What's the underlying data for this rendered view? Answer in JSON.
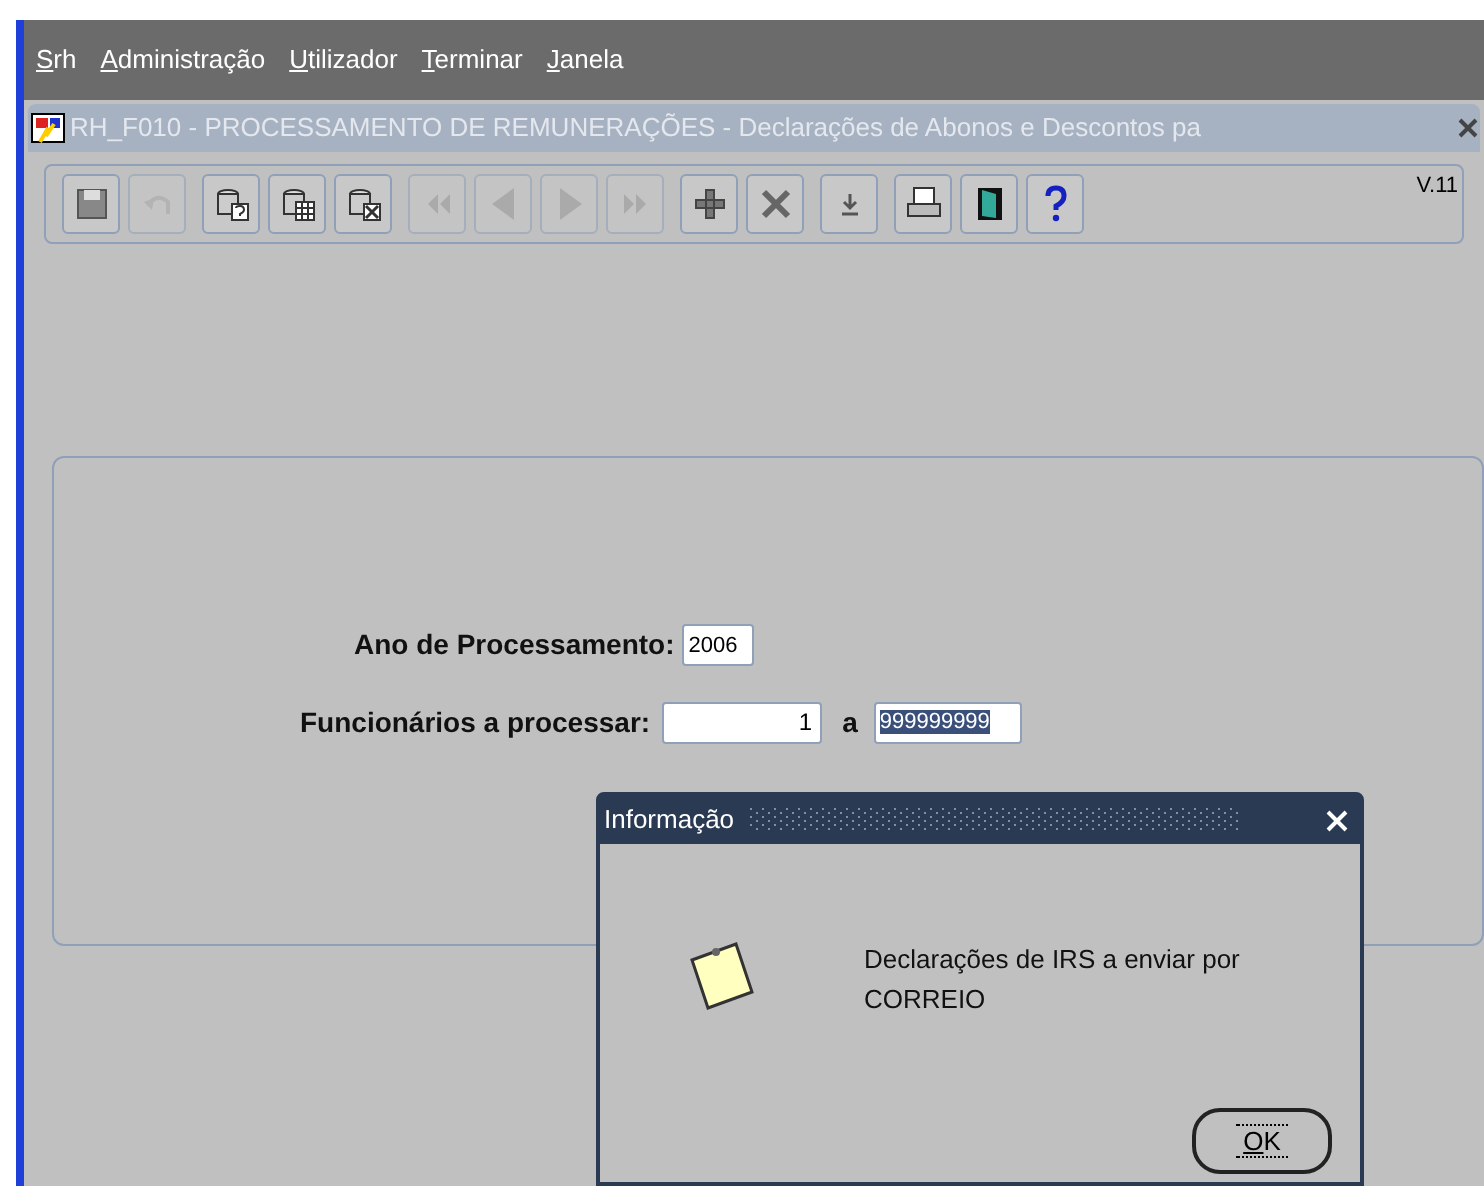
{
  "menu": [
    {
      "mnemonic": "S",
      "rest": "rh"
    },
    {
      "mnemonic": "A",
      "rest": "dministração"
    },
    {
      "mnemonic": "U",
      "rest": "tilizador"
    },
    {
      "mnemonic": "T",
      "rest": "erminar"
    },
    {
      "mnemonic": "J",
      "rest": "anela"
    }
  ],
  "window": {
    "title": "RH_F010 - PROCESSAMENTO DE REMUNERAÇÕES - Declarações de Abonos e Descontos pa",
    "version": "V.11"
  },
  "toolbar": [
    {
      "kind": "save",
      "disabled": false
    },
    {
      "kind": "undo",
      "disabled": true
    },
    {
      "kind": "query",
      "disabled": false
    },
    {
      "kind": "execute",
      "disabled": false
    },
    {
      "kind": "cancel",
      "disabled": false
    },
    {
      "kind": "first",
      "disabled": true
    },
    {
      "kind": "prev",
      "disabled": true
    },
    {
      "kind": "next",
      "disabled": true
    },
    {
      "kind": "last",
      "disabled": true
    },
    {
      "kind": "insert",
      "disabled": false
    },
    {
      "kind": "delete",
      "disabled": false
    },
    {
      "kind": "download",
      "disabled": false
    },
    {
      "kind": "print",
      "disabled": false
    },
    {
      "kind": "exit",
      "disabled": false
    },
    {
      "kind": "help",
      "disabled": false
    }
  ],
  "form": {
    "year_label": "Ano de Processamento:",
    "year": "2006",
    "employees_label": "Funcionários a processar:",
    "from": "1",
    "to_label": "a",
    "to": "999999999",
    "to_selected": true
  },
  "dialog": {
    "title": "Informação",
    "message": "Declarações de IRS a enviar por CORREIO",
    "ok": {
      "mnemonic": "O",
      "rest": "K"
    }
  }
}
